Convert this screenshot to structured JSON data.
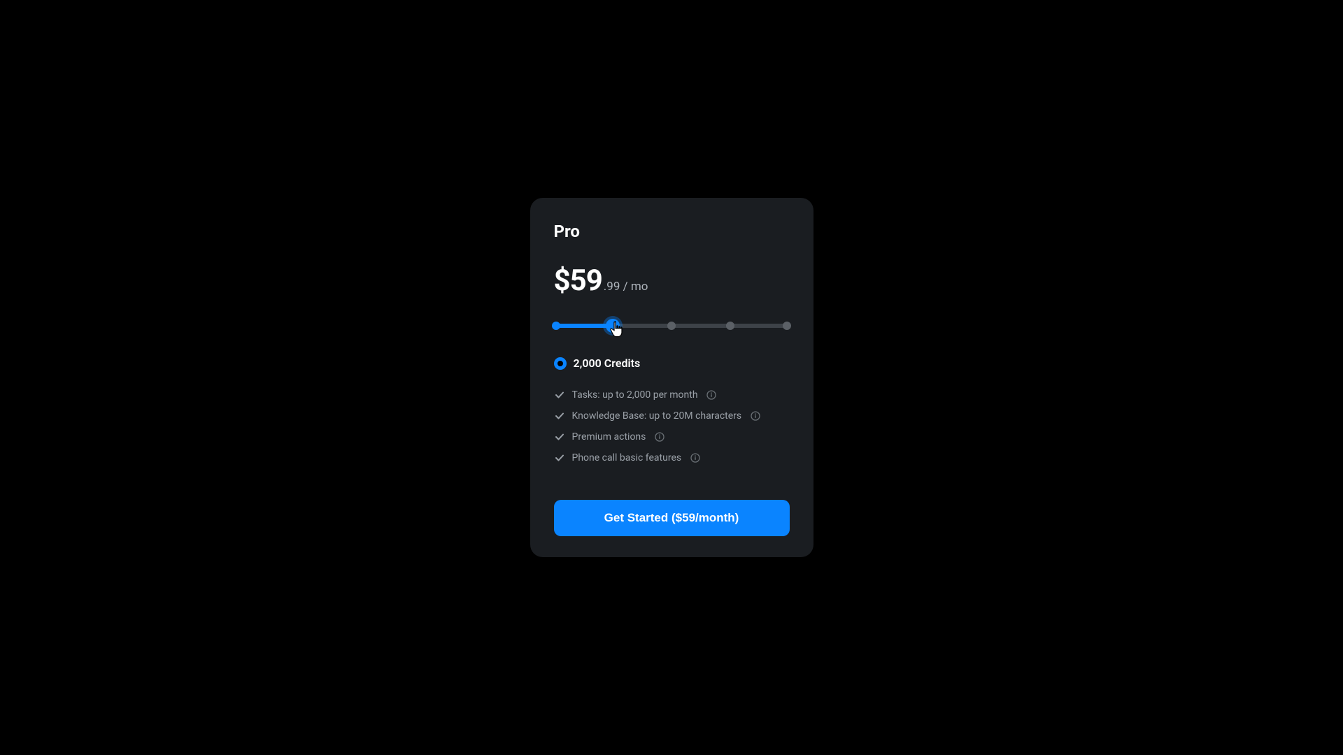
{
  "plan": {
    "name": "Pro",
    "price_main": "$59",
    "price_suffix": ".99 / mo"
  },
  "slider": {
    "selected_index": 1,
    "stops": 5
  },
  "credits": {
    "label": "2,000 Credits"
  },
  "features": [
    {
      "text": "Tasks: up to 2,000 per month"
    },
    {
      "text": "Knowledge Base: up to 20M characters"
    },
    {
      "text": "Premium actions"
    },
    {
      "text": "Phone call basic features"
    }
  ],
  "cta": {
    "label": "Get Started ($59/month)"
  },
  "colors": {
    "accent": "#0a84ff",
    "card_bg": "#1a1d21",
    "muted": "#9ba1a8"
  }
}
